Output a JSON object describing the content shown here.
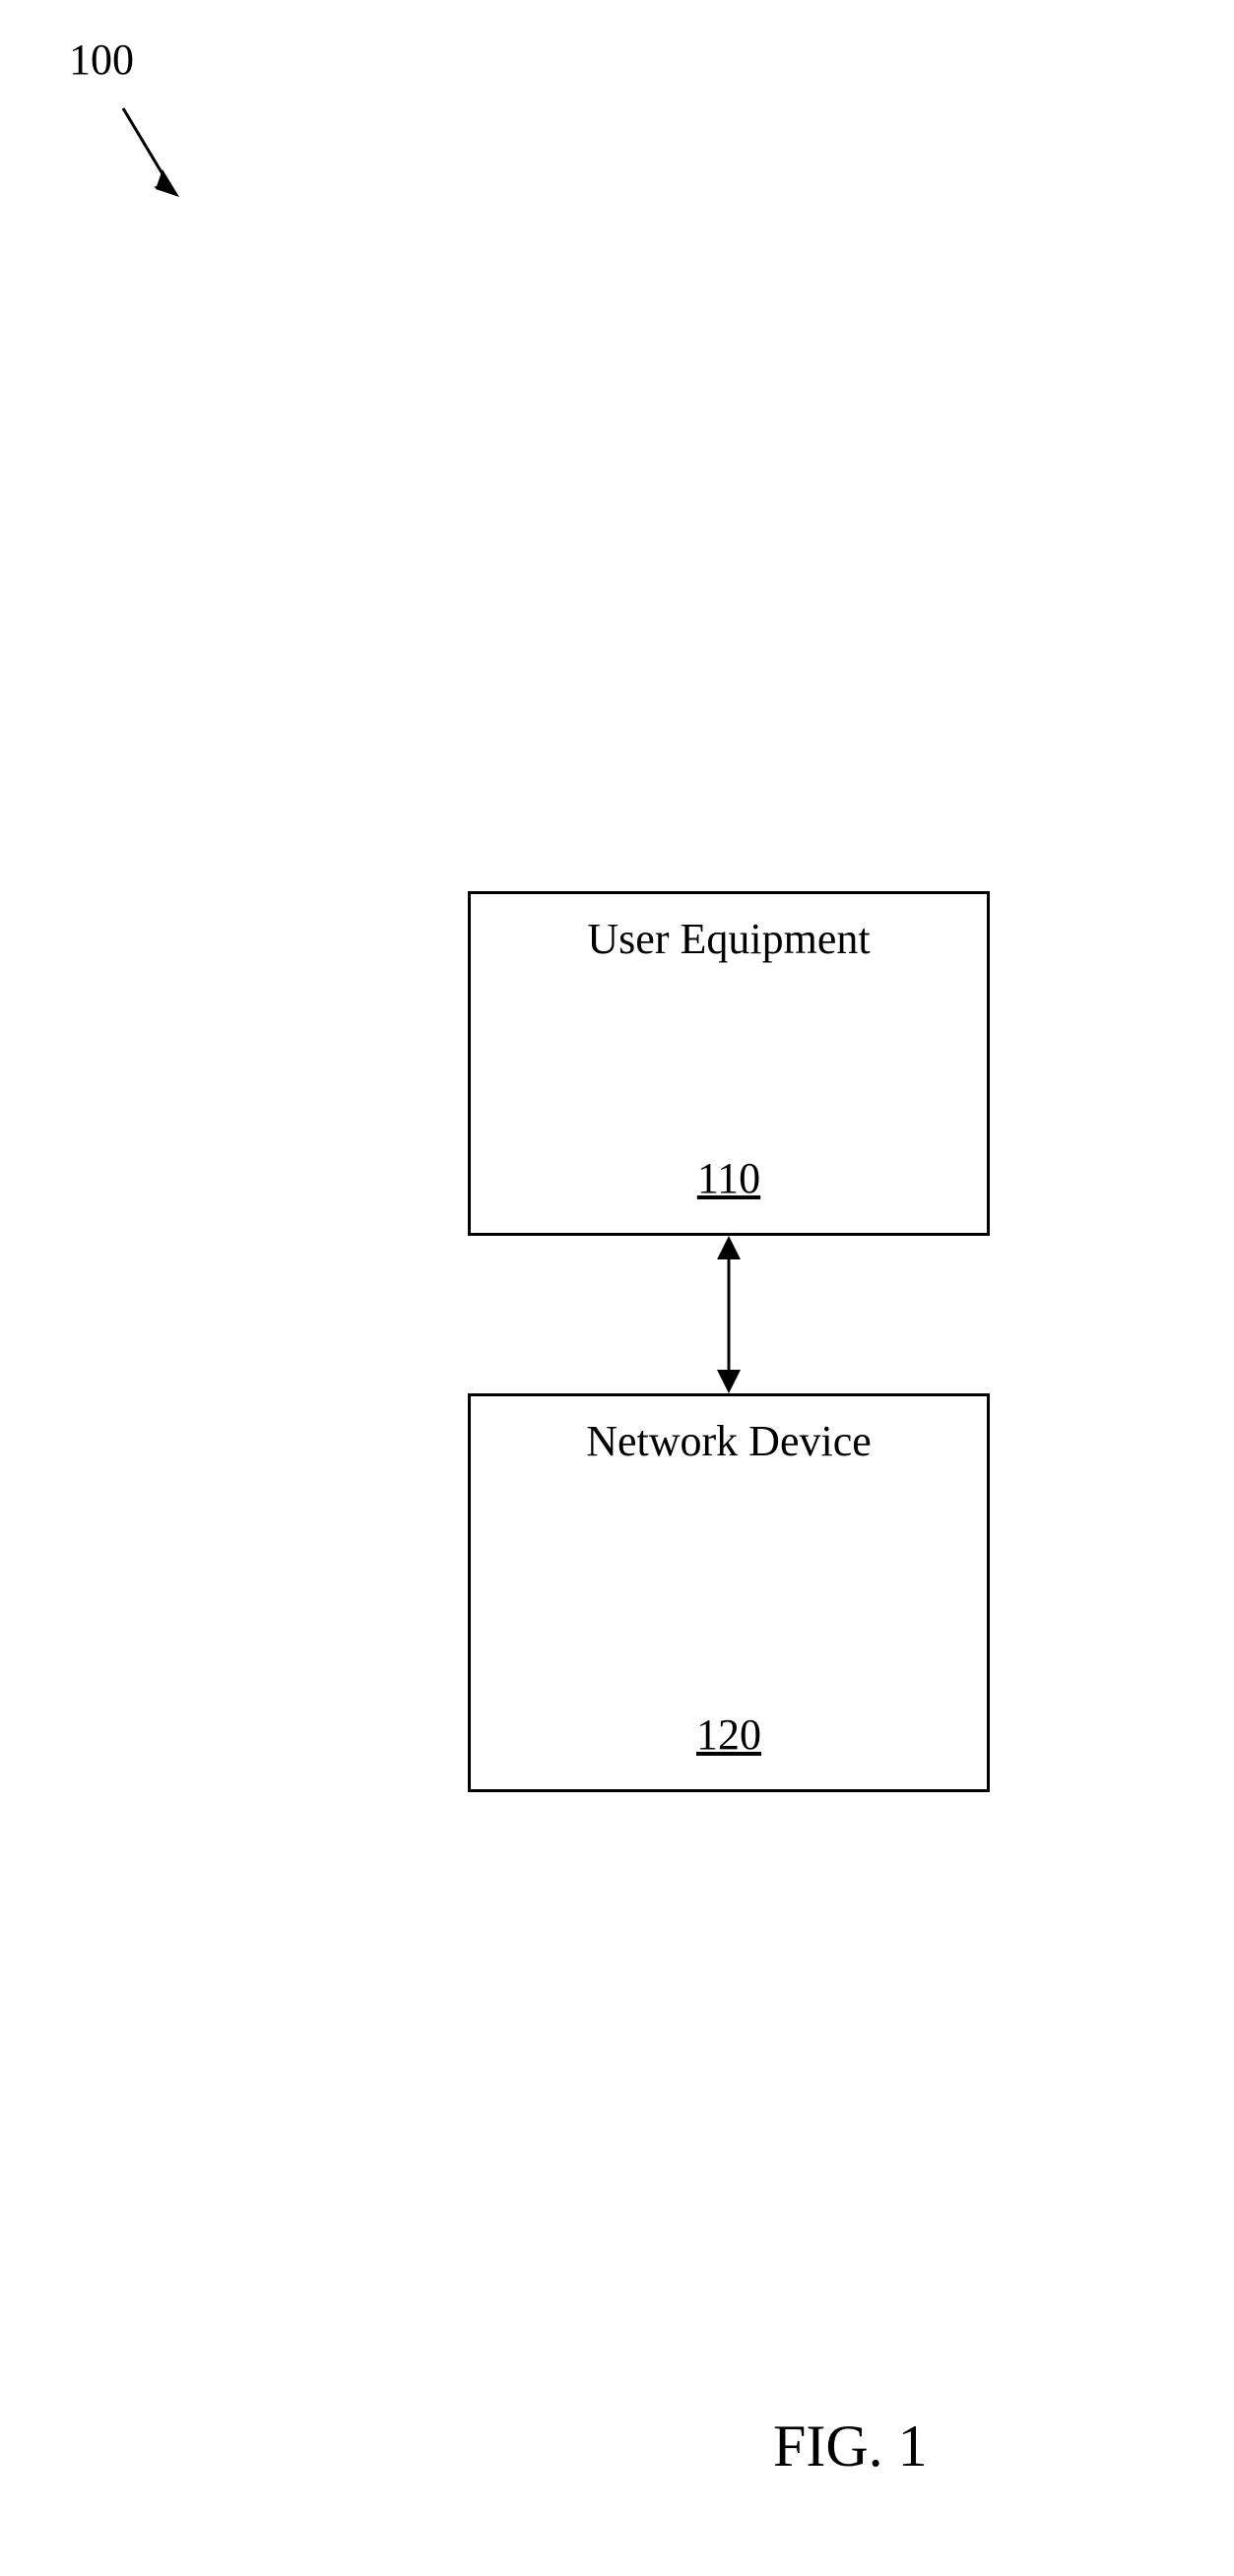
{
  "refLabel": "100",
  "box1": {
    "title": "User Equipment",
    "number": "110"
  },
  "box2": {
    "title": "Network Device",
    "number": "120"
  },
  "caption": "FIG. 1"
}
